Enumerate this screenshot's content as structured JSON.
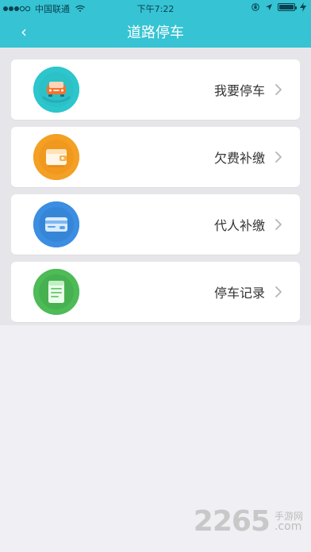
{
  "statusbar": {
    "carrier": "中国联通",
    "time": "下午7:22"
  },
  "nav": {
    "title": "道路停车"
  },
  "menu": {
    "items": [
      {
        "label": "我要停车",
        "icon": "car-icon",
        "color": "#27c2c8"
      },
      {
        "label": "欠费补缴",
        "icon": "wallet-icon",
        "color": "#f39c1f"
      },
      {
        "label": "代人补缴",
        "icon": "card-icon",
        "color": "#2f86d6"
      },
      {
        "label": "停车记录",
        "icon": "records-icon",
        "color": "#4bb24f"
      }
    ]
  },
  "watermark": {
    "number": "2265",
    "top_text": "手游网",
    "bottom_text": ".com"
  }
}
